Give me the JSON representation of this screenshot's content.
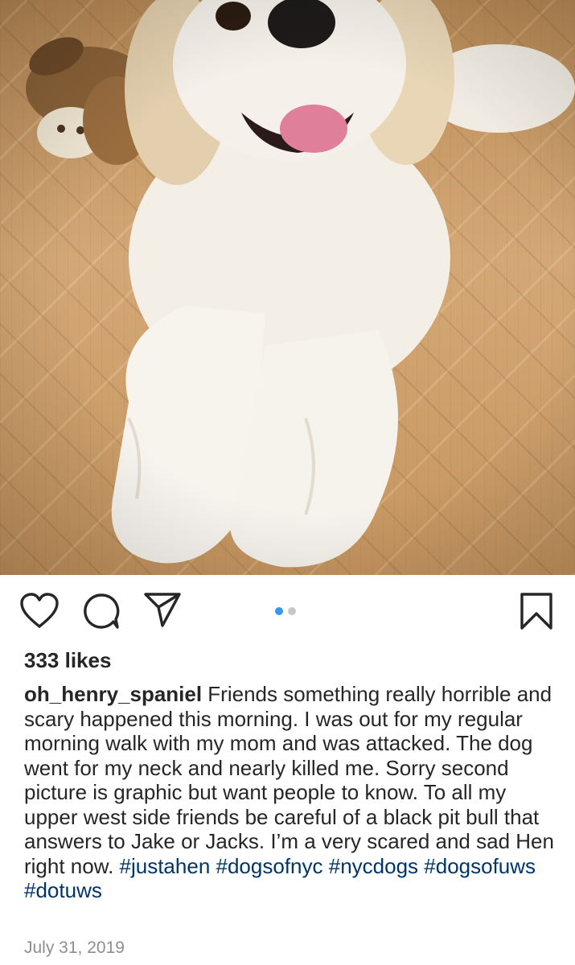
{
  "post": {
    "image_subject": "dog-photo",
    "carousel": {
      "count": 2,
      "active_index": 0
    },
    "likes_text": "333 likes",
    "username": "oh_henry_spaniel",
    "caption_text": " Friends something really horrible and scary happened this morning.  I was out for my regular morning walk with my mom and was attacked.  The dog went for my neck and nearly killed me.  Sorry second picture is graphic but want people to know.  To all my upper west side friends be careful of a black pit bull that answers to Jake or Jacks.  I’m a very scared and sad Hen right now. ",
    "hashtags": [
      "#justahen",
      "#dogsofnyc",
      "#nycdogs",
      "#dogsofuws",
      "#dotuws"
    ],
    "date": "July 31, 2019"
  },
  "actions": {
    "like_icon": "heart-icon",
    "comment_icon": "comment-icon",
    "share_icon": "paper-plane-icon",
    "save_icon": "bookmark-icon"
  },
  "colors": {
    "hashtag": "#003569",
    "active_dot": "#3897f0",
    "inactive_dot": "#c7c7c7",
    "date": "#8e8e8e"
  }
}
